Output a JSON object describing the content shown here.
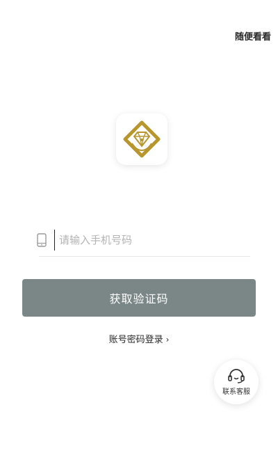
{
  "header": {
    "skip_label": "随便看看"
  },
  "login": {
    "phone_placeholder": "请输入手机号码",
    "submit_label": "获取验证码",
    "alt_login_label": "账号密码登录"
  },
  "fab": {
    "label": "联系客服"
  },
  "colors": {
    "brand_gold": "#b8962e",
    "button_bg": "#7b8686"
  }
}
